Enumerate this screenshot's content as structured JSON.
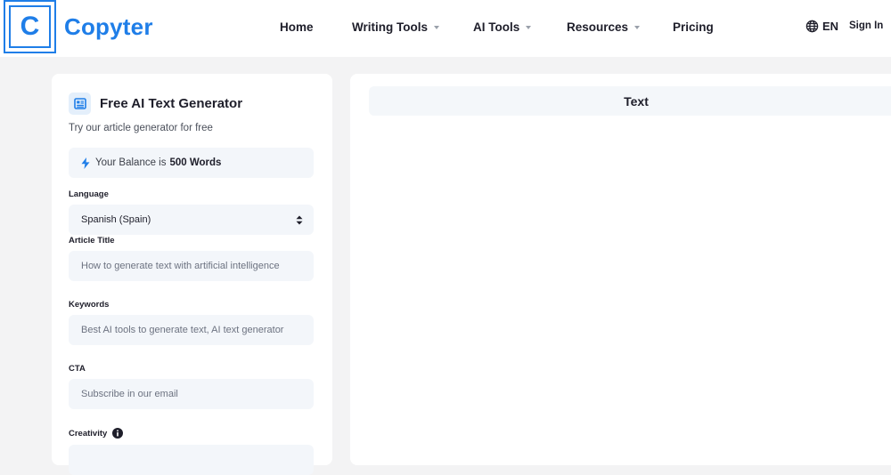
{
  "brand": {
    "logo_letter": "C",
    "name": "Copyter",
    "color": "#1f7ee8"
  },
  "nav": {
    "items": [
      {
        "label": "Home",
        "dropdown": false
      },
      {
        "label": "Writing Tools",
        "dropdown": true
      },
      {
        "label": "AI Tools",
        "dropdown": true
      },
      {
        "label": "Resources",
        "dropdown": true
      },
      {
        "label": "Pricing",
        "dropdown": false
      }
    ],
    "language": "EN",
    "language_icon": "globe-icon",
    "sign_in": "Sign In"
  },
  "generator": {
    "icon": "document-icon",
    "title": "Free AI Text Generator",
    "subtitle": "Try our article generator for free",
    "balance_prefix": "Your Balance is",
    "balance_value": "500 Words",
    "balance_icon": "lightning-icon",
    "language_label": "Language",
    "language_value": "Spanish (Spain)",
    "title_label": "Article Title",
    "title_placeholder": "How to generate text with artificial intelligence",
    "keywords_label": "Keywords",
    "keywords_placeholder": "Best AI tools to generate text, AI text generator",
    "cta_label": "CTA",
    "cta_placeholder": "Subscribe in our email",
    "creativity_label": "Creativity"
  },
  "output": {
    "tab_label": "Text"
  }
}
